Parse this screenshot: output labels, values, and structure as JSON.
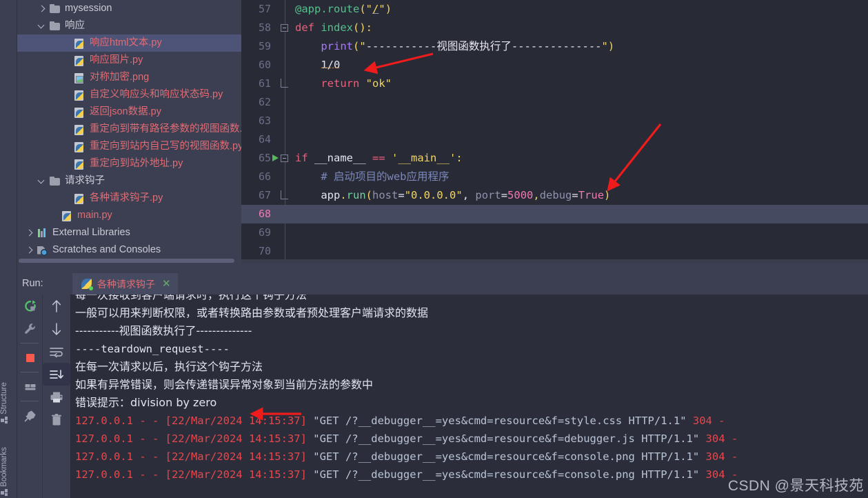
{
  "window": {
    "theme_colors": {
      "sidebar_bg": "#3c3f51",
      "editor_bg": "#282a36",
      "console_bg": "#2b2d3a",
      "selection_bg": "#4e5478",
      "current_line_bg": "#464a60",
      "accent_red": "#e5484d",
      "accent_green": "#56c08d"
    }
  },
  "sidebar_tools": {
    "structure_label": "Structure",
    "bookmarks_label": "Bookmarks"
  },
  "project_tree": {
    "items": [
      {
        "label": "mysession",
        "type": "folder",
        "indent": 1,
        "chevron": "right",
        "selected": false,
        "color": "plain"
      },
      {
        "label": "响应",
        "type": "folder",
        "indent": 1,
        "chevron": "down",
        "selected": false,
        "color": "plain"
      },
      {
        "label": "响应html文本.py",
        "type": "py",
        "indent": 3,
        "chevron": "none",
        "selected": true,
        "color": "red"
      },
      {
        "label": "响应图片.py",
        "type": "py",
        "indent": 3,
        "chevron": "none",
        "selected": false,
        "color": "red"
      },
      {
        "label": "对称加密.png",
        "type": "png",
        "indent": 3,
        "chevron": "none",
        "selected": false,
        "color": "red"
      },
      {
        "label": "自定义响应头和响应状态码.py",
        "type": "py",
        "indent": 3,
        "chevron": "none",
        "selected": false,
        "color": "red"
      },
      {
        "label": "返回json数据.py",
        "type": "py",
        "indent": 3,
        "chevron": "none",
        "selected": false,
        "color": "red"
      },
      {
        "label": "重定向到带有路径参数的视图函数.py",
        "type": "py",
        "indent": 3,
        "chevron": "none",
        "selected": false,
        "color": "red"
      },
      {
        "label": "重定向到站内自己写的视图函数.py",
        "type": "py",
        "indent": 3,
        "chevron": "none",
        "selected": false,
        "color": "red"
      },
      {
        "label": "重定向到站外地址.py",
        "type": "py",
        "indent": 3,
        "chevron": "none",
        "selected": false,
        "color": "red"
      },
      {
        "label": "请求钩子",
        "type": "folder",
        "indent": 1,
        "chevron": "down",
        "selected": false,
        "color": "plain"
      },
      {
        "label": "各种请求钩子.py",
        "type": "py",
        "indent": 3,
        "chevron": "none",
        "selected": false,
        "color": "red"
      },
      {
        "label": "main.py",
        "type": "py",
        "indent": 2,
        "chevron": "none",
        "selected": false,
        "color": "red"
      },
      {
        "label": "External Libraries",
        "type": "libs",
        "indent": 0,
        "chevron": "right",
        "selected": false,
        "color": "plain"
      },
      {
        "label": "Scratches and Consoles",
        "type": "scratch",
        "indent": 0,
        "chevron": "right",
        "selected": false,
        "color": "plain"
      }
    ]
  },
  "editor": {
    "lines": [
      {
        "num": "57",
        "marker": "none",
        "fold": "none",
        "current": false,
        "tokens": [
          {
            "t": "@app.route",
            "c": "t-dec"
          },
          {
            "t": "(",
            "c": "t-punc"
          },
          {
            "t": "\"",
            "c": "t-str"
          },
          {
            "t": "/",
            "c": "t-str t-undl"
          },
          {
            "t": "\"",
            "c": "t-str"
          },
          {
            "t": ")",
            "c": "t-punc"
          }
        ]
      },
      {
        "num": "58",
        "marker": "none",
        "fold": "start",
        "current": false,
        "tokens": [
          {
            "t": "def ",
            "c": "t-kw"
          },
          {
            "t": "index",
            "c": "t-fn"
          },
          {
            "t": "():",
            "c": "t-punc"
          }
        ]
      },
      {
        "num": "59",
        "marker": "none",
        "fold": "none",
        "current": false,
        "tokens": [
          {
            "t": "    ",
            "c": ""
          },
          {
            "t": "print",
            "c": "t-builtin"
          },
          {
            "t": "(",
            "c": "t-punc"
          },
          {
            "t": "\"",
            "c": "t-str"
          },
          {
            "t": "-----------视图函数执行了--------------",
            "c": "t-strw"
          },
          {
            "t": "\"",
            "c": "t-str"
          },
          {
            "t": ")",
            "c": "t-punc"
          }
        ]
      },
      {
        "num": "60",
        "marker": "none",
        "fold": "none",
        "current": false,
        "tokens": [
          {
            "t": "    ",
            "c": ""
          },
          {
            "t": "1/0",
            "c": "t-ident t-err"
          }
        ]
      },
      {
        "num": "61",
        "marker": "none",
        "fold": "end",
        "current": false,
        "tokens": [
          {
            "t": "    ",
            "c": ""
          },
          {
            "t": "return ",
            "c": "t-kw"
          },
          {
            "t": "\"ok\"",
            "c": "t-str"
          }
        ]
      },
      {
        "num": "62",
        "marker": "none",
        "fold": "none",
        "current": false,
        "tokens": []
      },
      {
        "num": "63",
        "marker": "none",
        "fold": "none",
        "current": false,
        "tokens": []
      },
      {
        "num": "64",
        "marker": "none",
        "fold": "none",
        "current": false,
        "tokens": []
      },
      {
        "num": "65",
        "marker": "run",
        "fold": "start",
        "current": false,
        "tokens": [
          {
            "t": "if ",
            "c": "t-kw"
          },
          {
            "t": "__name__ ",
            "c": "t-ident"
          },
          {
            "t": "== ",
            "c": "t-kw"
          },
          {
            "t": "'__main__'",
            "c": "t-str"
          },
          {
            "t": ":",
            "c": "t-punc"
          }
        ]
      },
      {
        "num": "66",
        "marker": "none",
        "fold": "none",
        "current": false,
        "tokens": [
          {
            "t": "    ",
            "c": ""
          },
          {
            "t": "# 启动项目的web应用程序",
            "c": "t-com"
          }
        ]
      },
      {
        "num": "67",
        "marker": "none",
        "fold": "end",
        "current": false,
        "tokens": [
          {
            "t": "    ",
            "c": ""
          },
          {
            "t": "app",
            "c": "t-ident"
          },
          {
            "t": ".",
            "c": "t-punc"
          },
          {
            "t": "run",
            "c": "t-fn2"
          },
          {
            "t": "(",
            "c": "t-punc"
          },
          {
            "t": "host",
            "c": "t-kwarg"
          },
          {
            "t": "=",
            "c": "t-ident"
          },
          {
            "t": "\"0.0.0.0\"",
            "c": "t-str"
          },
          {
            "t": ", ",
            "c": "t-ident"
          },
          {
            "t": "port",
            "c": "t-kwarg"
          },
          {
            "t": "=",
            "c": "t-ident"
          },
          {
            "t": "5000",
            "c": "t-num"
          },
          {
            "t": ",",
            "c": "t-punc"
          },
          {
            "t": "debug",
            "c": "t-kwarg"
          },
          {
            "t": "=",
            "c": "t-ident"
          },
          {
            "t": "True",
            "c": "t-num"
          },
          {
            "t": ")",
            "c": "t-punc"
          }
        ]
      },
      {
        "num": "68",
        "marker": "none",
        "fold": "none",
        "current": true,
        "tokens": []
      },
      {
        "num": "69",
        "marker": "none",
        "fold": "none",
        "current": false,
        "tokens": []
      },
      {
        "num": "70",
        "marker": "none",
        "fold": "none",
        "current": false,
        "tokens": []
      }
    ]
  },
  "run_panel": {
    "run_label": "Run:",
    "tab_title": "各种请求钩子",
    "tab_close": "✕",
    "tools_left": [
      {
        "name": "rerun-button",
        "icon": "rerun-icon"
      },
      {
        "name": "settings-button",
        "icon": "wrench-icon"
      },
      {
        "name": "stop-button",
        "icon": "stop-icon"
      },
      {
        "name": "layout-button",
        "icon": "layout-icon"
      },
      {
        "name": "pin-button",
        "icon": "pin-icon"
      }
    ],
    "tools_right": [
      {
        "name": "scroll-up-button",
        "icon": "arrow-up-icon"
      },
      {
        "name": "scroll-down-button",
        "icon": "arrow-down-icon"
      },
      {
        "name": "soft-wrap-button",
        "icon": "soft-wrap-icon"
      },
      {
        "name": "scroll-to-end-button",
        "icon": "scroll-to-end-icon"
      },
      {
        "name": "print-button",
        "icon": "printer-icon"
      },
      {
        "name": "clear-all-button",
        "icon": "trash-icon"
      }
    ],
    "console_lines": [
      {
        "kind": "cn",
        "text": "每一次接收到客户端请求时，执行这个钩子方法"
      },
      {
        "kind": "cn",
        "text": "一般可以用来判断权限，或者转换路由参数或者预处理客户端请求的数据"
      },
      {
        "kind": "cn",
        "text": "-----------视图函数执行了--------------"
      },
      {
        "kind": "mono",
        "text": "----teardown_request----"
      },
      {
        "kind": "cn",
        "text": "在每一次请求以后，执行这个钩子方法"
      },
      {
        "kind": "cn",
        "text": "如果有异常错误，则会传递错误异常对象到当前方法的参数中"
      },
      {
        "kind": "cn",
        "text": "错误提示：division by zero"
      }
    ],
    "log_lines": [
      {
        "ip": "127.0.0.1 - - [22/Mar/2024 14:15:37] ",
        "request": "\"GET /?__debugger__=yes&cmd=resource&f=style.css HTTP/1.1\" ",
        "status": "304 -"
      },
      {
        "ip": "127.0.0.1 - - [22/Mar/2024 14:15:37] ",
        "request": "\"GET /?__debugger__=yes&cmd=resource&f=debugger.js HTTP/1.1\" ",
        "status": "304 -"
      },
      {
        "ip": "127.0.0.1 - - [22/Mar/2024 14:15:37] ",
        "request": "\"GET /?__debugger__=yes&cmd=resource&f=console.png HTTP/1.1\" ",
        "status": "304 -"
      },
      {
        "ip": "127.0.0.1 - - [22/Mar/2024 14:15:37] ",
        "request": "\"GET /?__debugger__=yes&cmd=resource&f=console.png HTTP/1.1\" ",
        "status": "304 -"
      }
    ]
  },
  "annotations": {
    "arrow_color": "#ee1c1c",
    "arrows": [
      {
        "name": "arrow-to-divide-by-zero",
        "target": "1/0"
      },
      {
        "name": "arrow-to-debug-true",
        "target": "debug=True"
      },
      {
        "name": "arrow-to-error-message",
        "target": "错误提示：division by zero"
      }
    ]
  },
  "watermark": {
    "text": "CSDN @景天科技苑"
  }
}
